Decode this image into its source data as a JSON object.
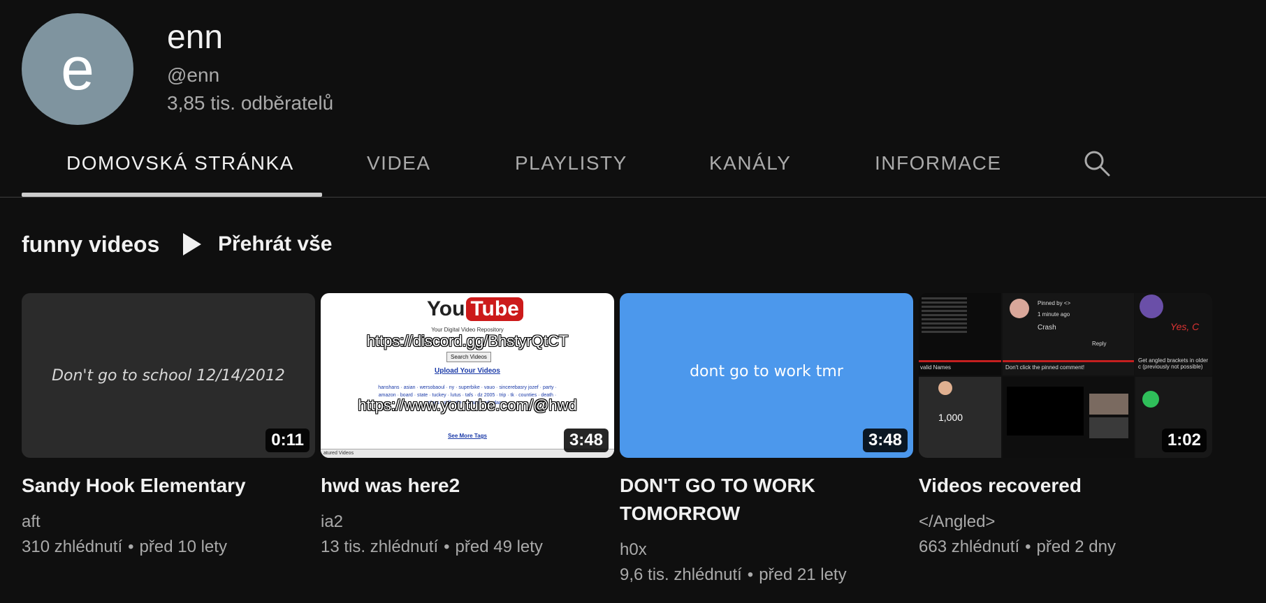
{
  "channel": {
    "avatar_letter": "e",
    "avatar_color": "#7f949f",
    "name": "enn",
    "handle": "@enn",
    "subscribers": "3,85 tis. odběratelů"
  },
  "tabs": [
    {
      "label": "DOMOVSKÁ STRÁNKA",
      "active": true
    },
    {
      "label": "VIDEA",
      "active": false
    },
    {
      "label": "PLAYLISTY",
      "active": false
    },
    {
      "label": "KANÁLY",
      "active": false
    },
    {
      "label": "INFORMACE",
      "active": false
    }
  ],
  "search_icon": "search-icon",
  "section": {
    "title": "funny videos",
    "play_all_label": "Přehrát vše",
    "play_icon": "play-icon"
  },
  "videos": [
    {
      "title": "Sandy Hook Elementary",
      "channel": "aft",
      "views": "310 zhlédnutí",
      "age": "před 10 lety",
      "duration": "0:11",
      "thumb_text": "Don't go to school 12/14/2012",
      "thumb_color": "#2b2b2b"
    },
    {
      "title": "hwd was here2",
      "channel": "ia2",
      "views": "13 tis. zhlédnutí",
      "age": "před 49 lety",
      "duration": "3:48",
      "thumb_logo_you": "You",
      "thumb_logo_tube": "Tube",
      "thumb_tagline": "Your Digital Video Repository",
      "thumb_overlay_1": "https://discord.gg/BhstyrQtCT",
      "thumb_search_btn": "Search Videos",
      "thumb_upload": "Upload Your Videos",
      "thumb_tags": "hanshans · asian · wersobaoul · ny · superbike · vauo · sincerebasry jozef · party · amazon · board · state · tuckey · lutus · tafs · dz 2005 · trip · tk · counties · death · class · still · ole · nature · ads dance",
      "thumb_overlay_2": "https://www.youtube.com/@hwd",
      "thumb_seemore": "See More Tags",
      "thumb_bottom": "atured Videos"
    },
    {
      "title": "DON'T GO TO WORK TOMORROW",
      "channel": "h0x",
      "views": "9,6 tis. zhlédnutí",
      "age": "před 21 lety",
      "duration": "3:48",
      "thumb_text": "dont go to work tmr",
      "thumb_color": "#4c98ec"
    },
    {
      "title": "Videos recovered",
      "channel": "</Angled>",
      "views": "663 zhlédnutí",
      "age": "před 2 dny",
      "duration": "1:02",
      "collage": {
        "pinned": "Pinned by <>",
        "time": "1 minute ago",
        "comment": "Crash",
        "reply": "Reply",
        "invalid": "valid Names",
        "dont_click": "Don't click the pinned comment!",
        "got_angled": "Get angled brackets in older c (previously not possible)",
        "count": "1,000",
        "handwriting": "Yes, C"
      }
    }
  ]
}
